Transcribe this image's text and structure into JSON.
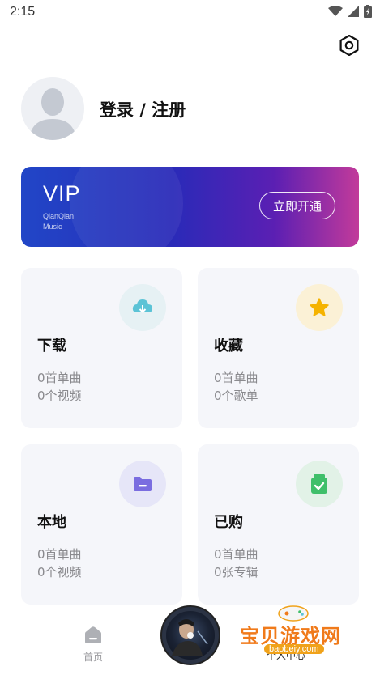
{
  "status_bar": {
    "time": "2:15"
  },
  "profile": {
    "login_label": "登录 / 注册"
  },
  "vip_banner": {
    "title": "VIP",
    "subtitle_line1": "QianQian",
    "subtitle_line2": "Music",
    "button_label": "立即开通"
  },
  "cards": [
    {
      "title": "下载",
      "line1": "0首单曲",
      "line2": "0个视频",
      "icon": "cloud-download-icon",
      "icon_bg": "#e6f1f4",
      "icon_color": "#5bc3d6"
    },
    {
      "title": "收藏",
      "line1": "0首单曲",
      "line2": "0个歌单",
      "icon": "star-icon",
      "icon_bg": "#fbf1d6",
      "icon_color": "#f5b300"
    },
    {
      "title": "本地",
      "line1": "0首单曲",
      "line2": "0个视频",
      "icon": "folder-icon",
      "icon_bg": "#e6e6f8",
      "icon_color": "#7a6de0"
    },
    {
      "title": "已购",
      "line1": "0首单曲",
      "line2": "0张专辑",
      "icon": "bag-check-icon",
      "icon_bg": "#e2f2e7",
      "icon_color": "#3fbf6a"
    }
  ],
  "tab_bar": {
    "home_label": "首页",
    "me_label": "个人中心"
  },
  "watermark": {
    "text": "宝贝游戏网",
    "url": "baobeiy.com"
  }
}
